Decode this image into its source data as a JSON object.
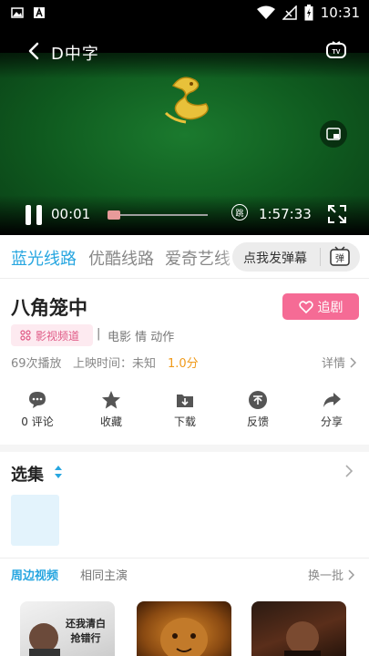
{
  "status_bar": {
    "time": "10:31",
    "icons": [
      "image-notification-icon",
      "text-notification-icon",
      "wifi-icon",
      "no-signal-icon",
      "battery-charging-icon"
    ]
  },
  "player": {
    "title": "D中字",
    "current_time": "00:01",
    "total_time": "1:57:33",
    "skip_label": "跳",
    "progress": 0.0
  },
  "lines": {
    "tabs": [
      {
        "label": "蓝光线路",
        "active": true
      },
      {
        "label": "优酷线路",
        "active": false
      },
      {
        "label": "爱奇艺线",
        "active": false
      }
    ],
    "danmu_placeholder": "点我发弹幕",
    "danmu_icon_text": "弹"
  },
  "info": {
    "title": "八角笼中",
    "follow_label": "追剧",
    "channel_label": "影视频道",
    "separator": "|",
    "tags": "电影 情 动作",
    "plays": "69次播放",
    "release": "上映时间：未知",
    "score": "1.0分",
    "detail_label": "详情"
  },
  "actions": [
    {
      "label": "0 评论",
      "icon": "comment-icon"
    },
    {
      "label": "收藏",
      "icon": "star-icon"
    },
    {
      "label": "下载",
      "icon": "download-icon"
    },
    {
      "label": "反馈",
      "icon": "feedback-icon"
    },
    {
      "label": "分享",
      "icon": "share-icon"
    }
  ],
  "episodes": {
    "title": "选集"
  },
  "related": {
    "tabs": [
      {
        "label": "周边视频",
        "active": true
      },
      {
        "label": "相同主演",
        "active": false
      }
    ],
    "refresh_label": "换一批",
    "thumb_caption": "还我清白 抢错行"
  },
  "colors": {
    "accent_blue": "#27a6e0",
    "accent_pink": "#f56b95",
    "score_orange": "#f09a1a",
    "video_green": "#1b7a2e"
  }
}
